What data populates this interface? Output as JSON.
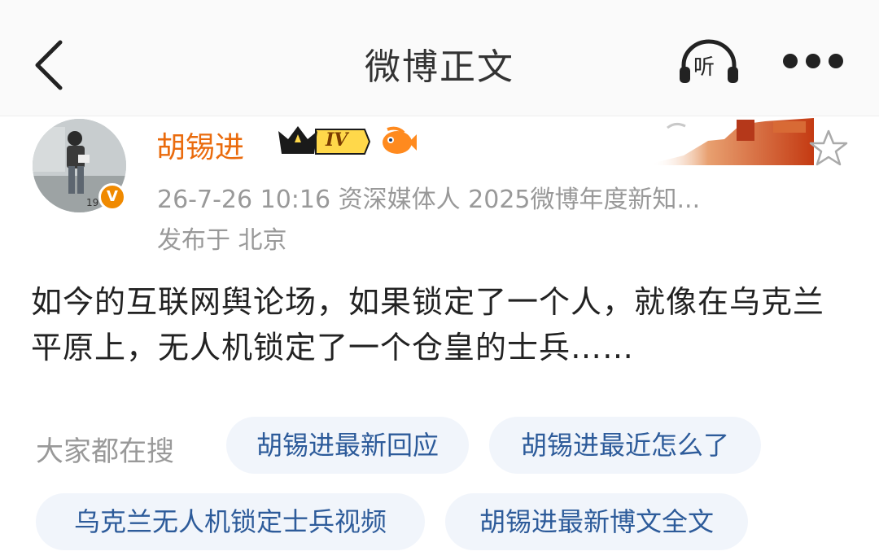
{
  "header": {
    "title": "微博正文",
    "listen_label": "听"
  },
  "post": {
    "username": "胡锡进",
    "vip_level": "IV",
    "verify_mark": "V",
    "avatar_caption": "19",
    "meta": "26-7-26 10:16  资深媒体人 2025微博年度新知...",
    "location": "发布于 北京",
    "content": "如今的互联网舆论场，如果锁定了一个人，就像在乌克兰平原上，无人机锁定了一个仓皇的士兵……"
  },
  "search": {
    "label": "大家都在搜",
    "chips": [
      "胡锡进最新回应",
      "胡锡进最近怎么了",
      "乌克兰无人机锁定士兵视频",
      "胡锡进最新博文全文"
    ]
  },
  "colors": {
    "username": "#ea6b0d",
    "chip_bg": "#f1f5fb",
    "chip_text": "#2d5b9a",
    "meta_text": "#999999",
    "verify": "#f08a00"
  }
}
